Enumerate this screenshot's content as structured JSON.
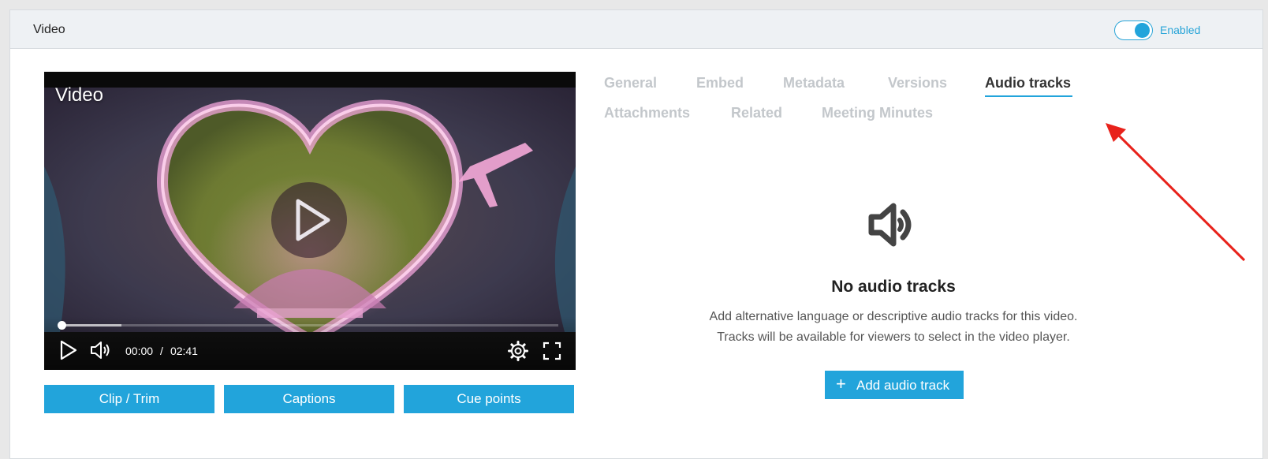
{
  "header": {
    "title": "Video",
    "toggle_label": "Enabled",
    "toggle_on": true
  },
  "video": {
    "overlay_title": "Video",
    "current_time": "00:00",
    "time_separator": "/",
    "duration": "02:41",
    "progress": 0
  },
  "actions": {
    "clip_label": "Clip / Trim",
    "captions_label": "Captions",
    "cue_points_label": "Cue points"
  },
  "tabs": [
    {
      "label": "General",
      "active": false
    },
    {
      "label": "Embed",
      "active": false
    },
    {
      "label": "Metadata",
      "active": false
    },
    {
      "label": "Versions",
      "active": false
    },
    {
      "label": "Audio tracks",
      "active": true
    },
    {
      "label": "Attachments",
      "active": false
    },
    {
      "label": "Related",
      "active": false
    },
    {
      "label": "Meeting Minutes",
      "active": false
    }
  ],
  "empty_state": {
    "icon": "speaker-icon",
    "title": "No audio tracks",
    "desc_line1": "Add alternative language or descriptive audio tracks for this video.",
    "desc_line2": "Tracks will be available for viewers to select in the video player.",
    "add_button_label": "Add audio track"
  },
  "colors": {
    "accent": "#22a4db",
    "annotation_arrow": "#e8221b"
  }
}
